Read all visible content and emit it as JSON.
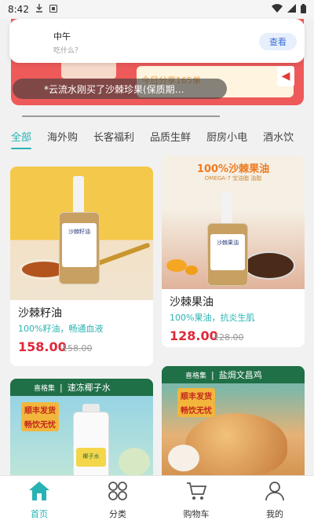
{
  "status_bar": {
    "time": "8:42"
  },
  "notification": {
    "title": "中午",
    "subtitle": "吃什么？",
    "action_label": "查看"
  },
  "banner": {
    "share_text": "今日分享165单"
  },
  "toast": {
    "text": "*云流水刚买了沙棘珍果(保质期…"
  },
  "tabs": [
    {
      "label": "全部",
      "active": true
    },
    {
      "label": "海外购"
    },
    {
      "label": "长客福利"
    },
    {
      "label": "品质生鲜"
    },
    {
      "label": "厨房小电"
    },
    {
      "label": "酒水饮"
    }
  ],
  "products": [
    {
      "name": "沙棘籽油",
      "desc": "100%籽油，畅通血液",
      "price": "158.00",
      "original_price": "158.00",
      "bottle_label": "沙棘籽油"
    },
    {
      "name": "沙棘果油",
      "desc": "100%果油，抗炎生肌",
      "price": "128.00",
      "original_price": "128.00",
      "banner_text": "100%沙棘果油",
      "banner_sub": "OMEGA-7 宝油脂 油脂",
      "bottle_label": "沙棘果油"
    },
    {
      "brand": "喜格集",
      "banner_text": "速冻椰子水",
      "tag1": "顺丰发货",
      "tag2": "畅饮无忧",
      "bottle_label": "椰子水"
    },
    {
      "brand": "喜格集",
      "banner_text": "盐焗文昌鸡",
      "tag1": "顺丰发货",
      "tag2": "畅饮无忧"
    }
  ],
  "bottom_nav": [
    {
      "label": "首页",
      "icon": "home-icon",
      "active": true
    },
    {
      "label": "分类",
      "icon": "category-icon"
    },
    {
      "label": "购物车",
      "icon": "cart-icon"
    },
    {
      "label": "我的",
      "icon": "user-icon"
    }
  ],
  "colors": {
    "accent": "#27b3b3",
    "price": "#e0283a",
    "banner": "#ee5a5a"
  }
}
